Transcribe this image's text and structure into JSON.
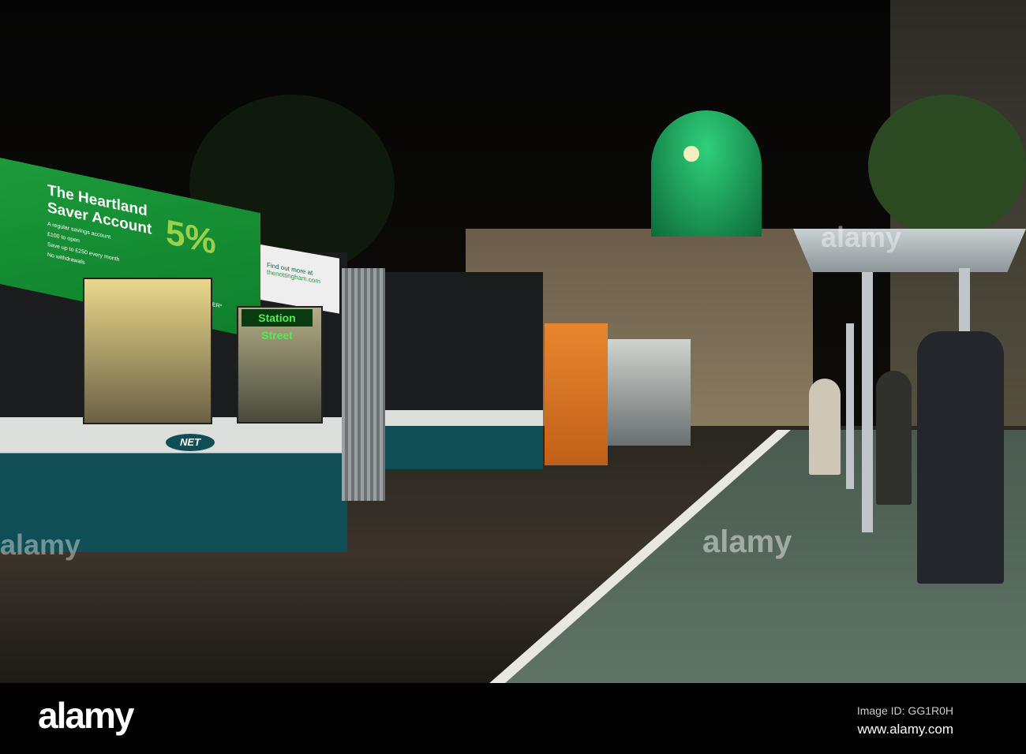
{
  "tram": {
    "destination": "Station Street",
    "operator_logo": "NET",
    "ad": {
      "headline_line1": "The Heartland",
      "headline_line2": "Saver Account",
      "rate": "5%",
      "bullets": [
        "A regular savings account",
        "£100 to open",
        "Save up to £250 every month",
        "No withdrawals"
      ],
      "footnote": "Gross p.a./AER*",
      "cta": "Find out more at",
      "url": "thenottingham.com"
    }
  },
  "watermark": {
    "logo": "alamy",
    "image_id": "Image ID: GG1R0H",
    "site": "www.alamy.com"
  }
}
